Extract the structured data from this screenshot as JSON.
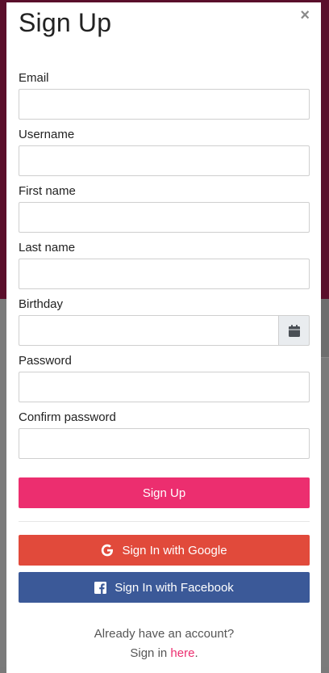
{
  "modal": {
    "title": "Sign Up",
    "close_glyph": "×"
  },
  "form": {
    "email": {
      "label": "Email",
      "value": ""
    },
    "username": {
      "label": "Username",
      "value": ""
    },
    "first_name": {
      "label": "First name",
      "value": ""
    },
    "last_name": {
      "label": "Last name",
      "value": ""
    },
    "birthday": {
      "label": "Birthday",
      "value": "",
      "icon": "calendar-icon"
    },
    "password": {
      "label": "Password",
      "value": ""
    },
    "confirm_password": {
      "label": "Confirm password",
      "value": ""
    }
  },
  "buttons": {
    "signup": "Sign Up",
    "google": "Sign In with Google",
    "facebook": "Sign In with Facebook"
  },
  "footer": {
    "line1": "Already have an account?",
    "line2_prefix": "Sign in ",
    "link": "here",
    "line2_suffix": "."
  },
  "colors": {
    "signup": "#ec2e6f",
    "google": "#e14a3b",
    "facebook": "#3b5998",
    "link": "#ec2e6f"
  }
}
